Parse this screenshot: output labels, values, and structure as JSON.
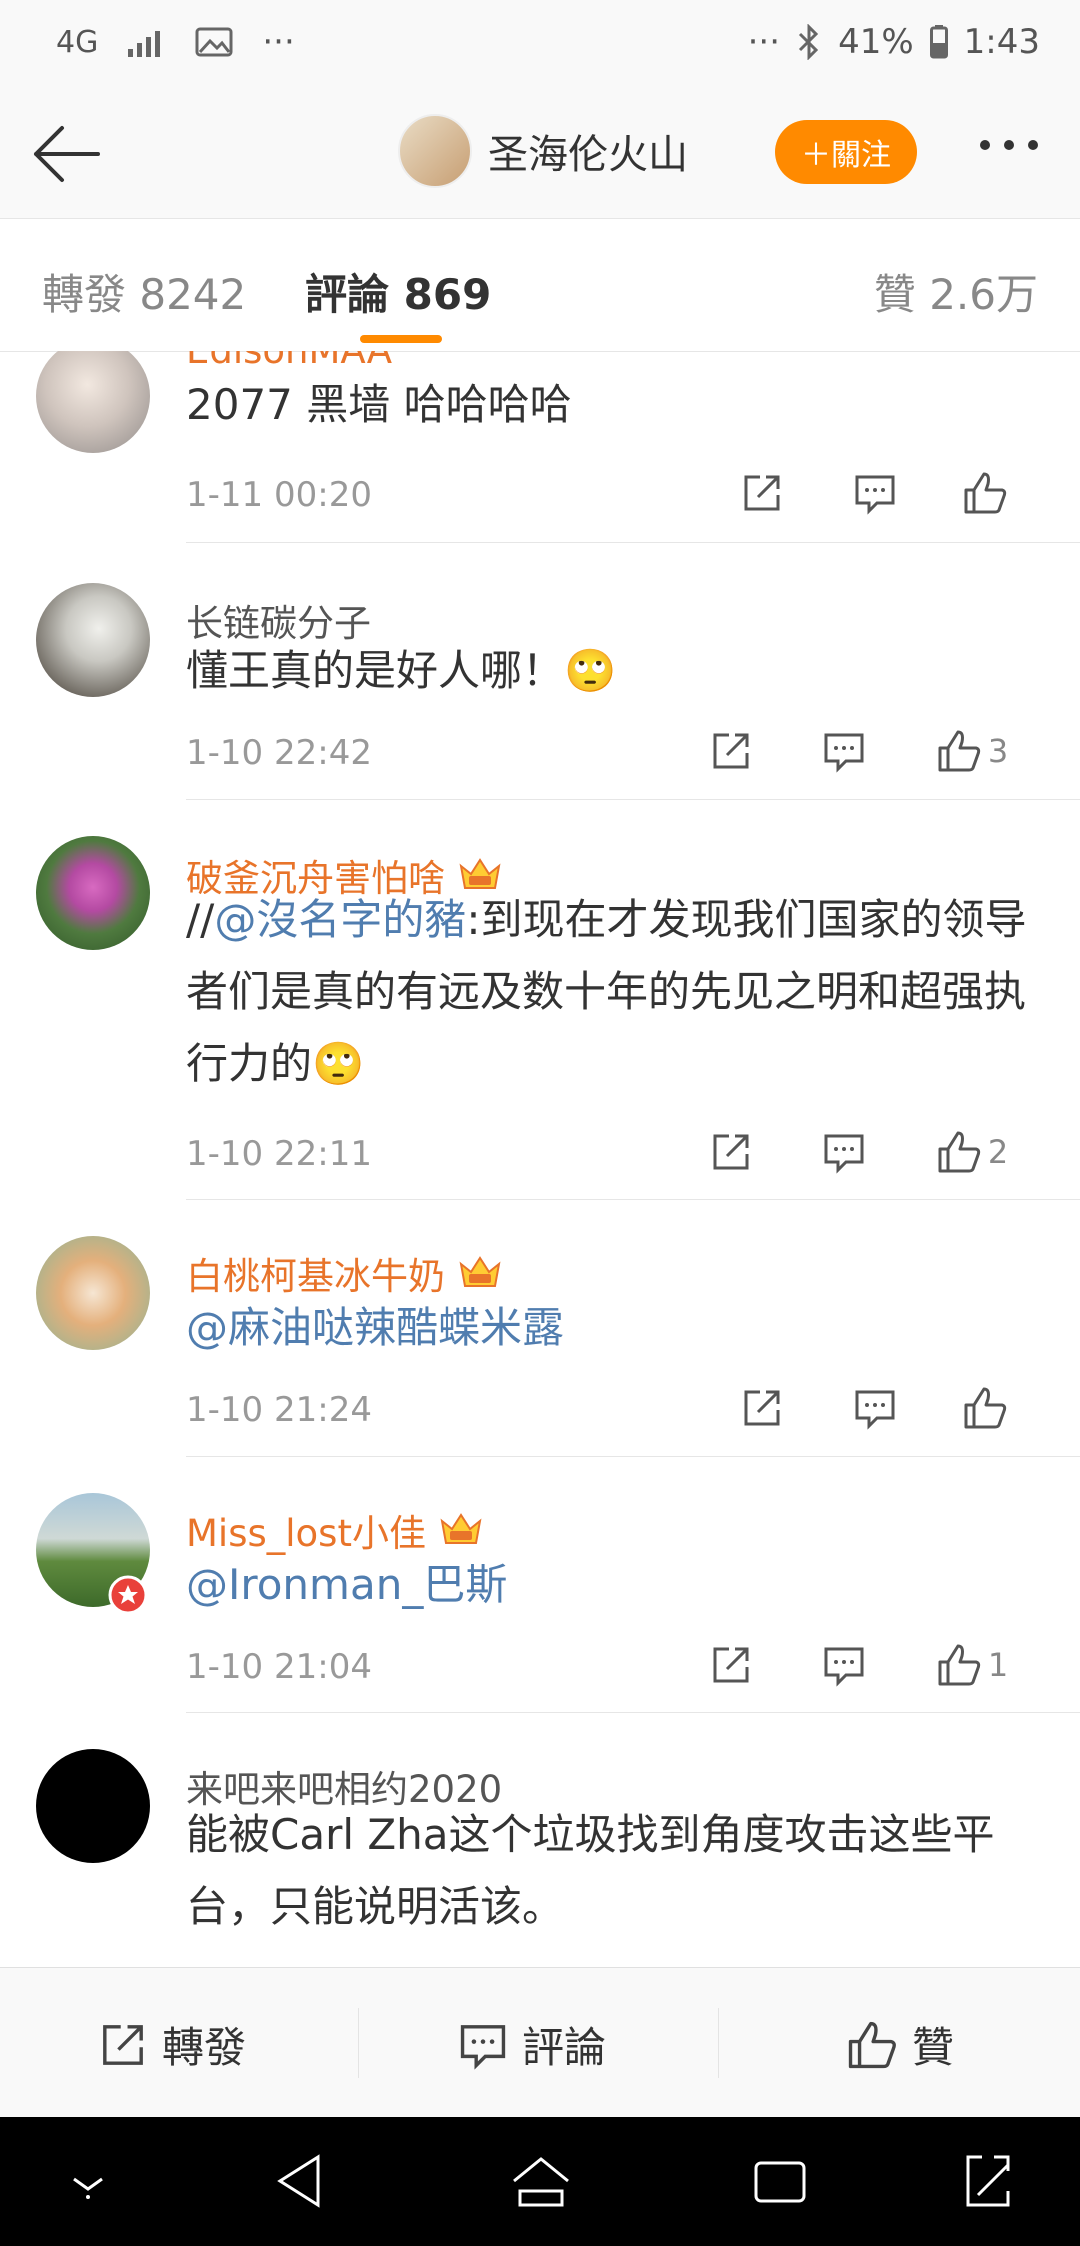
{
  "status_bar": {
    "network": "4G",
    "signal_icon": "signal-icon",
    "gallery_icon": "image-icon",
    "more": "···",
    "more_right": "···",
    "bluetooth_icon": "bluetooth-icon",
    "battery": "41%",
    "time": "1:43"
  },
  "header": {
    "title": "圣海伦火山",
    "follow_label": "＋關注"
  },
  "tabs": [
    {
      "label": "轉發 8242"
    },
    {
      "label": "評論 869"
    },
    {
      "label": "贊 2.6万"
    }
  ],
  "comments": [
    {
      "name": "EdisonMAA",
      "text": "2077 黑墙 哈哈哈哈",
      "time": "1-11 00:20",
      "likes": ""
    },
    {
      "name": "长链碳分子",
      "text": "懂王真的是好人哪！",
      "time": "1-10 22:42",
      "likes": "3"
    },
    {
      "name": "破釜沉舟害怕啥",
      "prefix": "//",
      "mention": "@沒名字的豬",
      "text": ":到现在才发现我们国家的领导者们是真的有远及数十年的先见之明和超强执行力的",
      "time": "1-10 22:11",
      "likes": "2"
    },
    {
      "name": "白桃柯基冰牛奶",
      "mention": "@麻油哒辣酷蝶米露",
      "time": "1-10 21:24",
      "likes": ""
    },
    {
      "name": "Miss_lost小佳",
      "mention": "@Ironman_巴斯",
      "time": "1-10 21:04",
      "likes": "1"
    },
    {
      "name": "来吧来吧相约2020",
      "text": "能被Carl Zha这个垃圾找到角度攻击这些平台，只能说明活该。"
    }
  ],
  "bottom_bar": {
    "repost": "轉發",
    "comment": "評論",
    "like": "贊"
  },
  "colors": {
    "accent": "#ff8a00",
    "vip_name": "#e8742a",
    "mention": "#507daf"
  }
}
